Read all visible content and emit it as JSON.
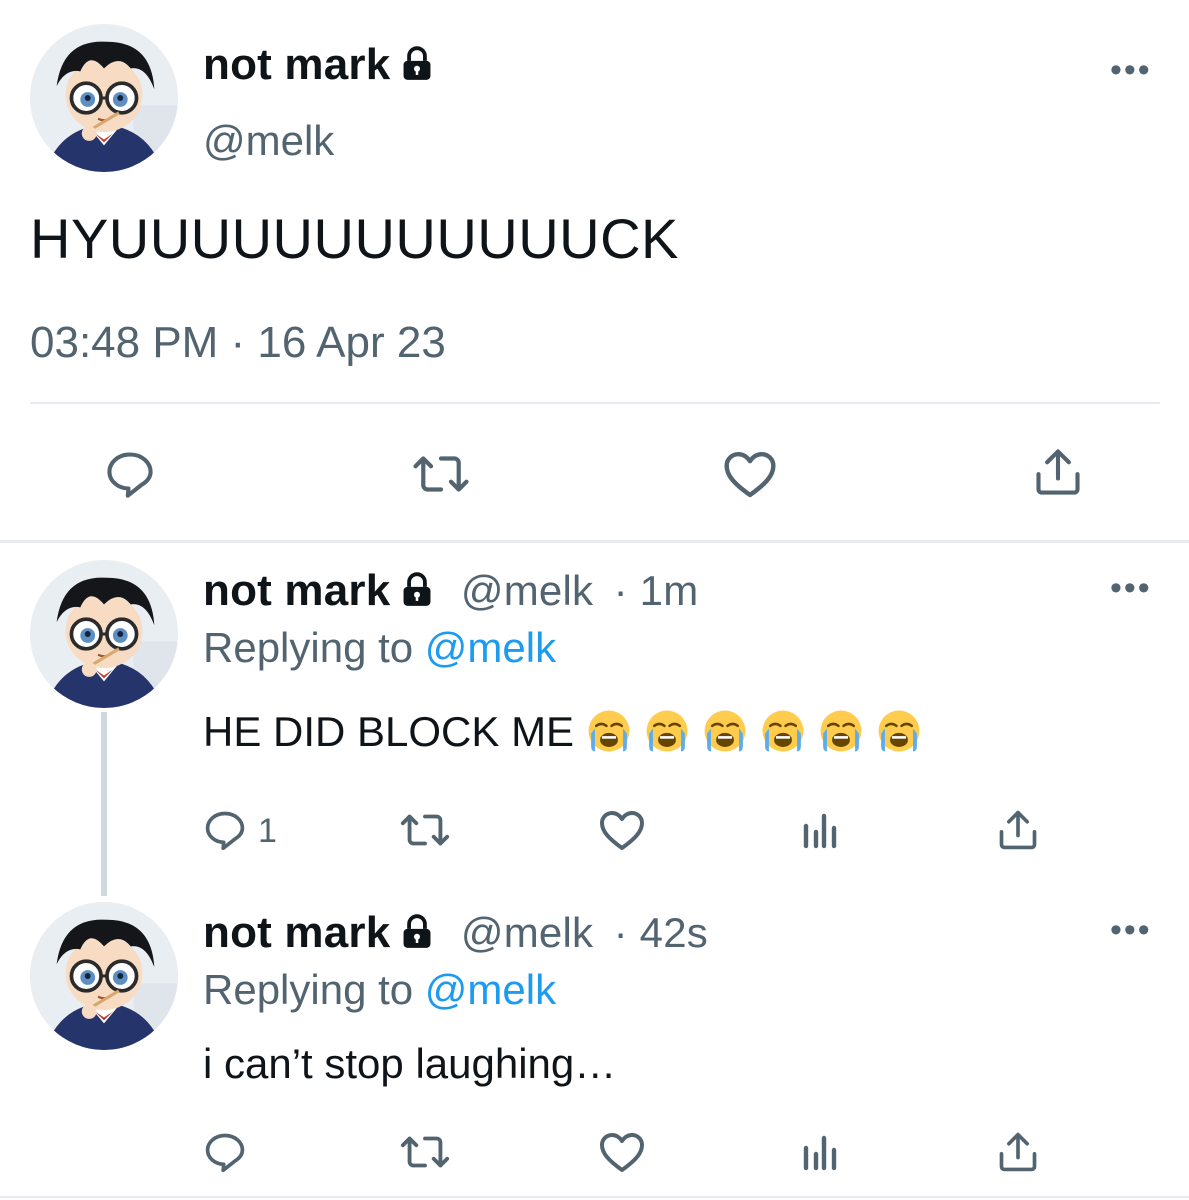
{
  "main_tweet": {
    "display_name": "not mark",
    "handle": "@melk",
    "text": "HYUUUUUUUUUUUUCK",
    "timestamp": "03:48 PM · 16 Apr 23",
    "more_label": "•••"
  },
  "replies": [
    {
      "display_name": "not mark",
      "handle": "@melk",
      "time": "· 1m",
      "replying_prefix": "Replying to",
      "replying_to": "@melk",
      "text": "HE DID BLOCK ME",
      "emoji_count": 6,
      "reply_count": "1",
      "more_label": "•••"
    },
    {
      "display_name": "not mark",
      "handle": "@melk",
      "time": "· 42s",
      "replying_prefix": "Replying to",
      "replying_to": "@melk",
      "text": "i can’t stop laughing…",
      "more_label": "•••"
    }
  ],
  "icons": {
    "lock": "lock-icon",
    "reply": "reply-icon",
    "retweet": "retweet-icon",
    "like": "like-icon",
    "views": "views-icon",
    "share": "share-icon",
    "emoji": "loudly-crying-face-emoji"
  },
  "colors": {
    "text": "#0f1419",
    "muted": "#536471",
    "link": "#1d9bf0",
    "divider": "#e7eaee"
  }
}
